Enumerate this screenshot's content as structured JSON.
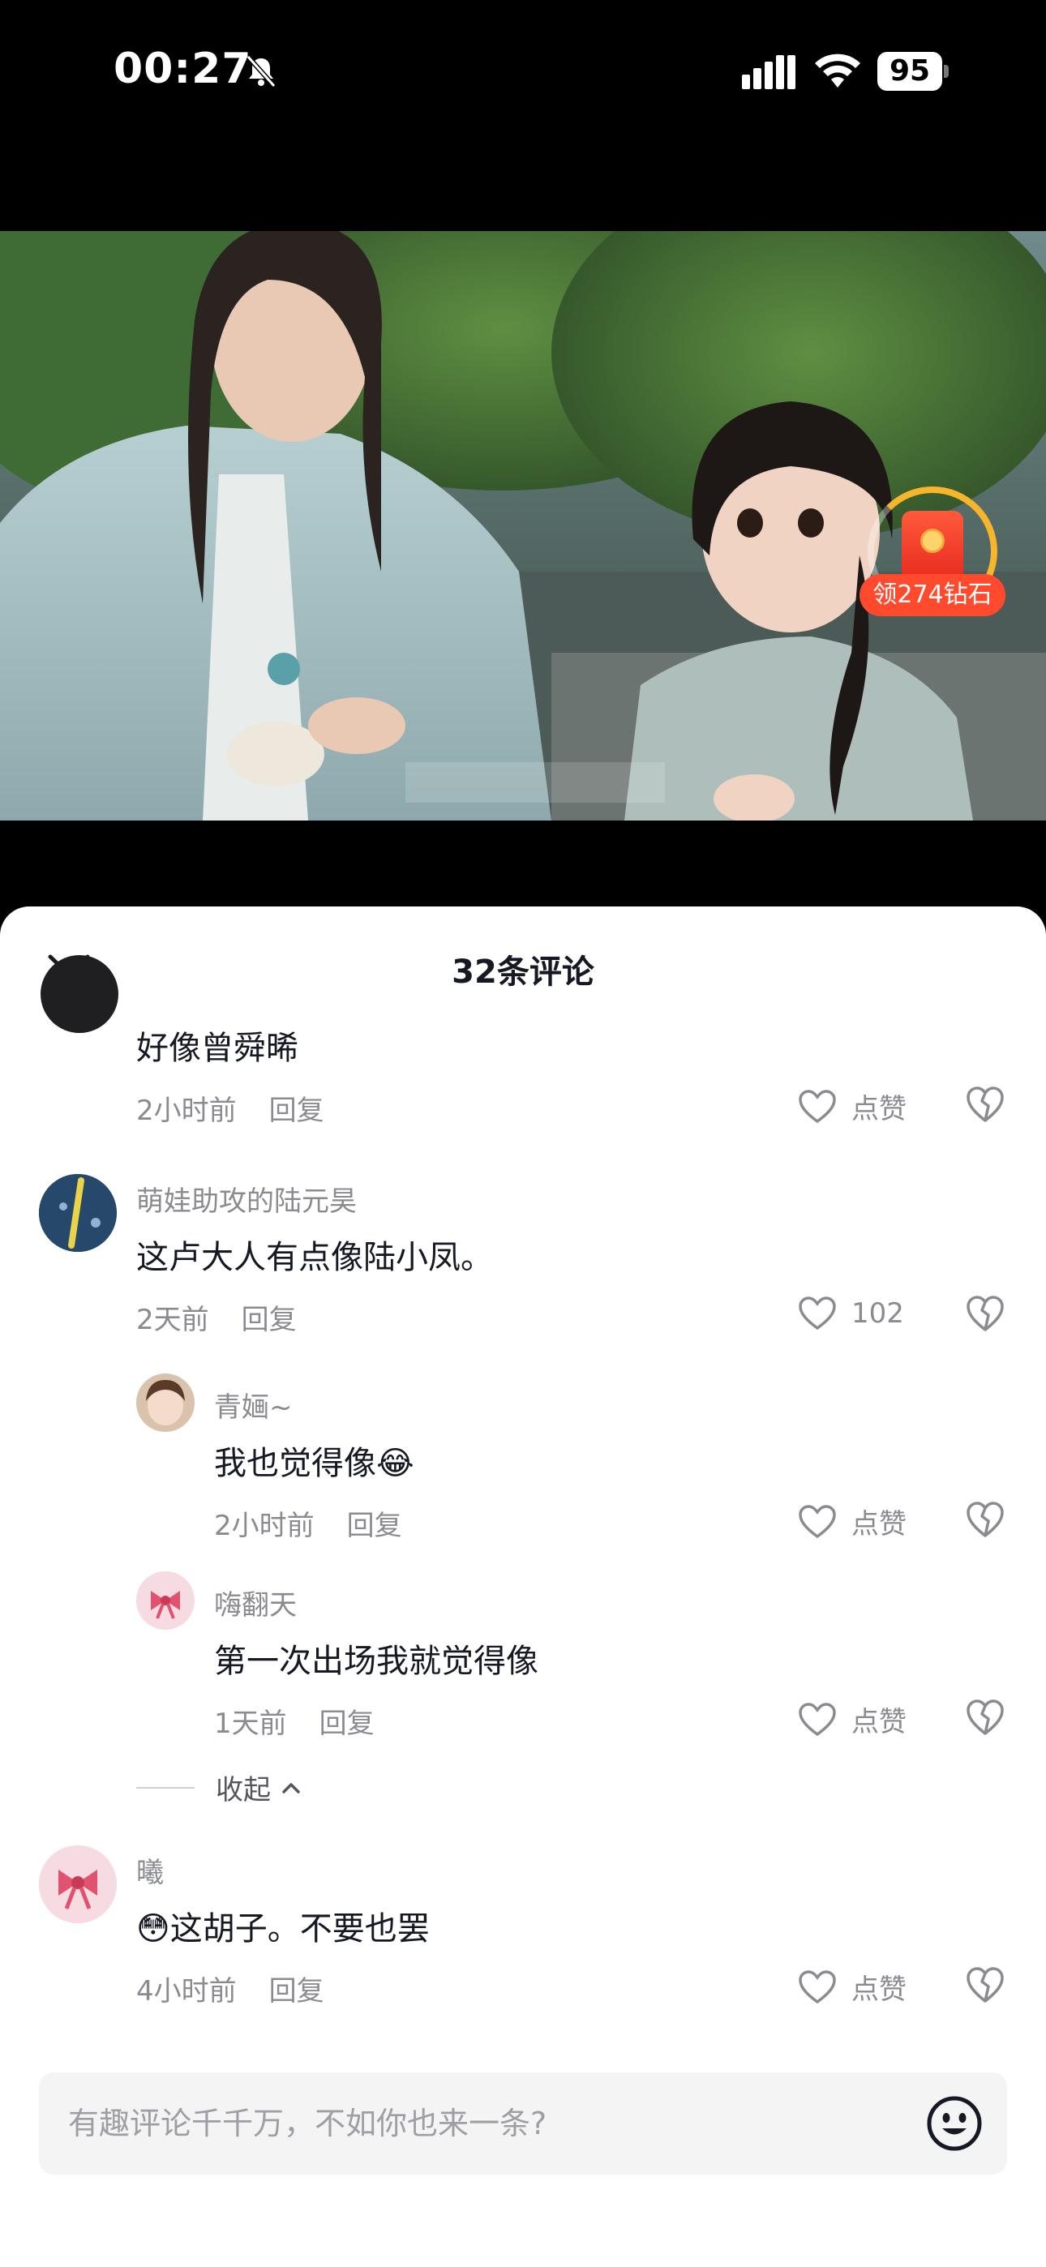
{
  "status": {
    "time": "00:27",
    "battery": "95"
  },
  "video": {
    "reward_label": "领274钻石"
  },
  "sheet": {
    "title": "32条评论",
    "input_placeholder": "有趣评论千千万，不如你也来一条?"
  },
  "comments": [
    {
      "text": "好像曾舜晞",
      "time": "2小时前",
      "reply": "回复",
      "likes": "点赞"
    },
    {
      "user": "萌娃助攻的陆元昊",
      "text": "这卢大人有点像陆小凤。",
      "time": "2天前",
      "reply": "回复",
      "likes": "102"
    },
    {
      "user": "青婳~",
      "text": "我也觉得像😂",
      "time": "2小时前",
      "reply": "回复",
      "likes": "点赞"
    },
    {
      "user": "嗨翻天",
      "text": "第一次出场我就觉得像",
      "time": "1天前",
      "reply": "回复",
      "likes": "点赞"
    },
    {
      "user": "曦",
      "text": "😳这胡子。不要也罢",
      "time": "4小时前",
      "reply": "回复",
      "likes": "点赞"
    }
  ],
  "collapse_label": "收起",
  "colors": {
    "accent_red": "#ff4a2e",
    "gold": "#f7b52c",
    "text_primary": "#161823",
    "text_secondary": "#8a8b91"
  }
}
